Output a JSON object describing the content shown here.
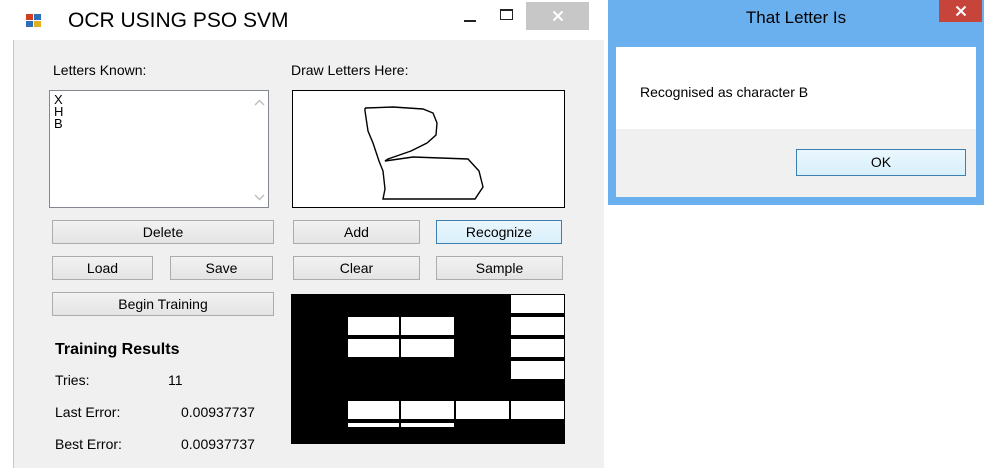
{
  "main_window": {
    "title": "OCR USING PSO SVM",
    "labels": {
      "letters_known": "Letters Known:",
      "draw_letters": "Draw Letters Here:",
      "training_results": "Training Results",
      "tries": "Tries:",
      "last_error": "Last Error:",
      "best_error": "Best Error:"
    },
    "letters_list": [
      "X",
      "H",
      "B"
    ],
    "buttons": {
      "delete": "Delete",
      "add": "Add",
      "recognize": "Recognize",
      "load": "Load",
      "save": "Save",
      "clear": "Clear",
      "sample": "Sample",
      "begin_training": "Begin Training"
    },
    "results": {
      "tries_value": "11",
      "last_error_value": "0.00937737",
      "best_error_value": "0.00937737"
    }
  },
  "dialog": {
    "title": "That Letter Is",
    "message": "Recognised as character B",
    "ok_label": "OK"
  },
  "icons": {
    "app": "app-window-icon",
    "minimize": "minimize-icon",
    "maximize": "maximize-icon",
    "close": "close-icon",
    "scroll_up": "chevron-up-icon",
    "scroll_down": "chevron-down-icon"
  },
  "colors": {
    "dialog_frame": "#6ab0ee",
    "dialog_close": "#c7443a",
    "focus_border": "#3c7fb1"
  }
}
